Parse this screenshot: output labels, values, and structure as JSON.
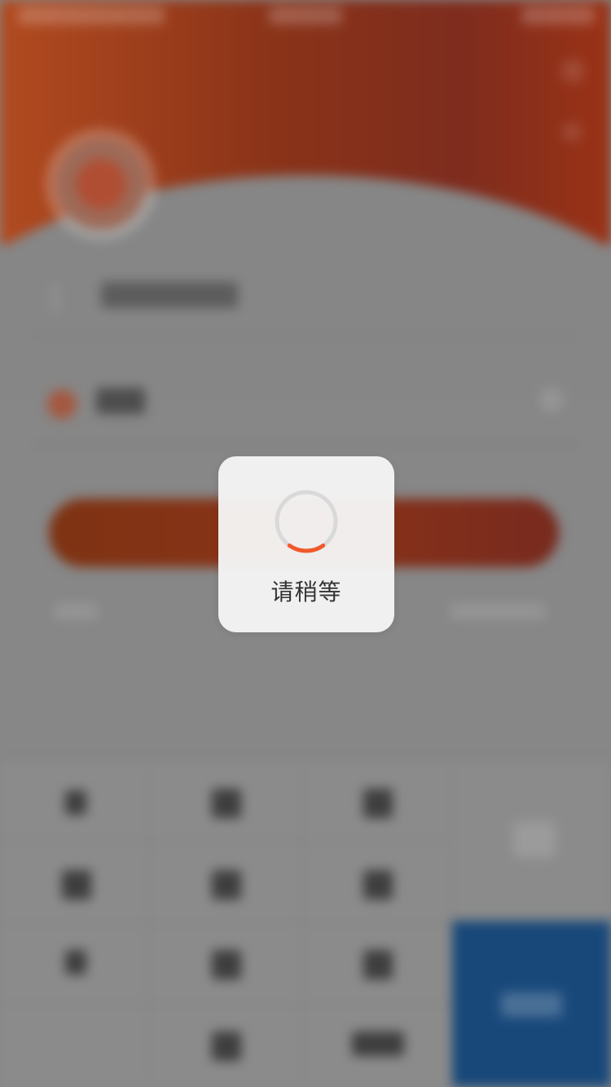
{
  "loading": {
    "message": "请稍等",
    "spinner_icon": "spinner-icon",
    "spinner_color": "#f0592b",
    "track_color": "#d9d9d9"
  },
  "colors": {
    "header_gradient_start": "#b14a1f",
    "header_gradient_end": "#7e2c1e",
    "confirm_key": "#18487a",
    "overlay_background": "#878787"
  }
}
